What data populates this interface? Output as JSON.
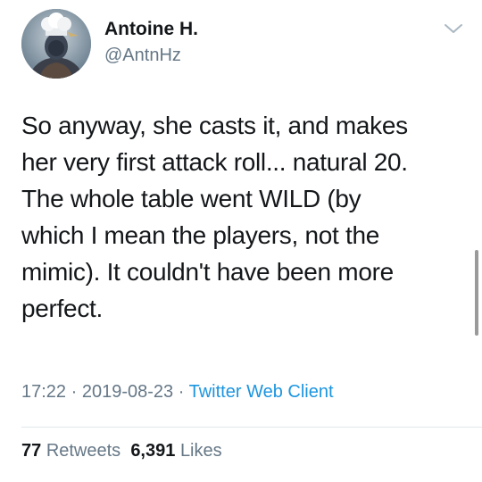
{
  "author": {
    "display_name": "Antoine H.",
    "handle": "@AntnHz",
    "avatar_icon": "chef-hat-avatar"
  },
  "tweet": {
    "lines": [
      "So anyway, she casts it, and makes",
      "her very first attack roll... natural 20.",
      "The whole table went WILD (by",
      "which I mean the players, not the",
      "mimic). It couldn't have been more",
      "perfect."
    ],
    "time": "17:22",
    "separator": "·",
    "date": "2019-08-23",
    "client": "Twitter Web Client"
  },
  "stats": {
    "retweets_count": "77",
    "retweets_label": "Retweets",
    "likes_count": "6,391",
    "likes_label": "Likes"
  },
  "colors": {
    "text": "#14171a",
    "secondary": "#657786",
    "link": "#1b95e0",
    "divider": "#e1e8ed"
  },
  "icons": {
    "caret": "chevron-down-icon"
  }
}
